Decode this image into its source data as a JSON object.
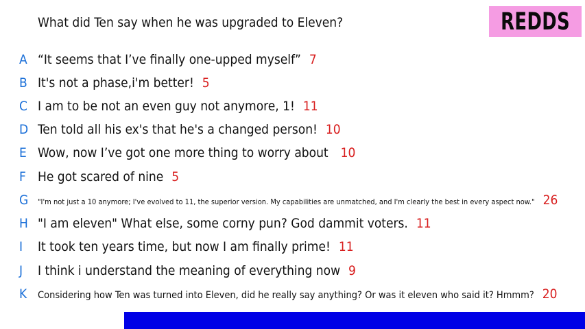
{
  "question": "What did Ten say when he was upgraded to Eleven?",
  "badge": "REDDS",
  "colors": {
    "letter": "#1a6fd8",
    "score": "#d81e1e",
    "badge_bg": "#f59ce3",
    "bottom_bar": "#0000e6"
  },
  "answers": [
    {
      "letter": "A",
      "text": "“It seems that I’ve finally one-upped myself”",
      "score": "7"
    },
    {
      "letter": "B",
      "text": "It's not a phase,i'm better!",
      "score": "5"
    },
    {
      "letter": "C",
      "text": "I am to be not an even guy not anymore, 1!",
      "score": "11"
    },
    {
      "letter": "D",
      "text": "Ten told all his ex's that he's a changed person!",
      "score": "10"
    },
    {
      "letter": "E",
      "text": "Wow, now I’ve got one more thing to worry about",
      "score": "10"
    },
    {
      "letter": "F",
      "text": "He got scared of nine",
      "score": "5"
    },
    {
      "letter": "G",
      "text": "\"I'm not just a 10 anymore; I've evolved to 11, the superior version. My capabilities are unmatched, and I'm clearly the best in every aspect now.\"",
      "score": "26"
    },
    {
      "letter": "H",
      "text": "\"I am eleven\" What else, some corny pun? God dammit voters.",
      "score": "11"
    },
    {
      "letter": "I",
      "text": "It took ten years time, but now I am finally prime!",
      "score": "11"
    },
    {
      "letter": "J",
      "text": "I think i understand the meaning of everything now",
      "score": "9"
    },
    {
      "letter": "K",
      "text": "Considering how Ten was turned into Eleven, did he really say anything? Or was it eleven who said it? Hmmm?",
      "score": "20"
    }
  ]
}
